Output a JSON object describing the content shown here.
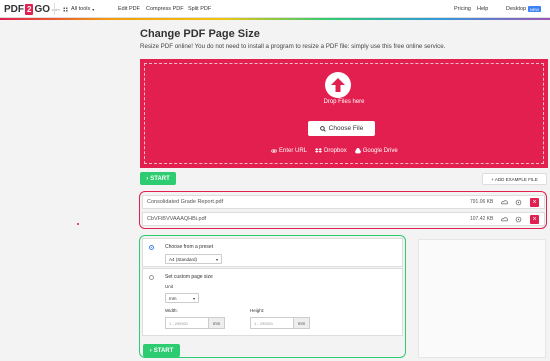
{
  "header": {
    "logo_left": "PDF",
    "logo_mid": "2",
    "logo_right": "GO",
    "logo_suffix": ".com",
    "all_tools": "All tools",
    "nav_items": [
      "Edit PDF",
      "Compress PDF",
      "Split PDF"
    ],
    "right_items": [
      "Pricing",
      "Help",
      "Desktop"
    ],
    "new_badge": "NEW"
  },
  "page": {
    "title": "Change PDF Page Size",
    "subtitle": "Resize PDF online! You do not need to install a program to resize a PDF file: simply use this free online service."
  },
  "upload": {
    "drop_label": "Drop Files here",
    "choose_label": "Choose File",
    "enter_url": "Enter URL",
    "dropbox": "Dropbox",
    "google_drive": "Google Drive"
  },
  "actions": {
    "start": "START",
    "add_example": "+ ADD EXAMPLE FILE"
  },
  "files": [
    {
      "name": "Consolidated Grade Report.pdf",
      "size": "791.06 KB"
    },
    {
      "name": "CbVFiBVVAAAQHBi.pdf",
      "size": "107.42 KB"
    }
  ],
  "options": {
    "preset_label": "Choose from a preset",
    "preset_value": "A4 (Standard)",
    "custom_label": "Set custom page size",
    "unit_label": "Unit",
    "unit_value": "mm",
    "width_label": "Width:",
    "height_label": "Height:",
    "width_placeholder": "1 - 295931",
    "height_placeholder": "1 - 295931",
    "unit_suffix": "mm"
  },
  "colors": {
    "brand_red": "#e21f4f",
    "start_green": "#2ecc71",
    "accent_blue": "#3b82f6"
  }
}
